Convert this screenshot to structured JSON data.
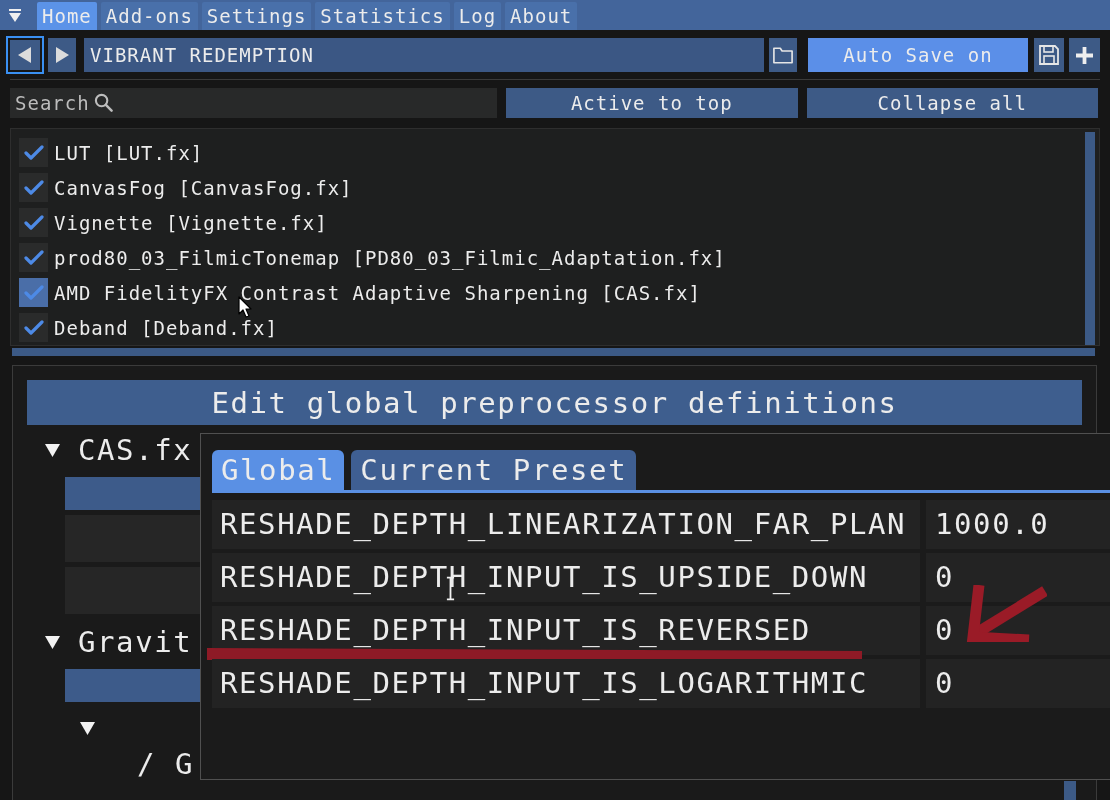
{
  "menu_tabs": [
    {
      "label": "Home",
      "selected": true
    },
    {
      "label": "Add-ons",
      "selected": false
    },
    {
      "label": "Settings",
      "selected": false
    },
    {
      "label": "Statistics",
      "selected": false
    },
    {
      "label": "Log",
      "selected": false
    },
    {
      "label": "About",
      "selected": false
    }
  ],
  "preset_bar": {
    "back_focused": true,
    "preset_name": "VIBRANT REDEMPTION",
    "auto_save": {
      "label": "Auto Save on",
      "on": true
    }
  },
  "search": {
    "placeholder": "Search"
  },
  "list_buttons": [
    "Active to top",
    "Collapse all"
  ],
  "effects": [
    {
      "label": "LUT [LUT.fx]",
      "checked": true,
      "hovered": false
    },
    {
      "label": "CanvasFog [CanvasFog.fx]",
      "checked": true,
      "hovered": false
    },
    {
      "label": "Vignette [Vignette.fx]",
      "checked": true,
      "hovered": false
    },
    {
      "label": "prod80_03_FilmicTonemap [PD80_03_Filmic_Adaptation.fx]",
      "checked": true,
      "hovered": false
    },
    {
      "label": "AMD FidelityFX Contrast Adaptive Sharpening [CAS.fx]",
      "checked": true,
      "hovered": true
    },
    {
      "label": "Deband [Deband.fx]",
      "checked": true,
      "hovered": false
    }
  ],
  "definitions": {
    "title": "Edit global preprocessor definitions",
    "tree": [
      {
        "label": "CAS.fx",
        "expanded": true,
        "children": [
          {
            "kind": "button"
          },
          {
            "kind": "field"
          },
          {
            "kind": "field"
          }
        ]
      },
      {
        "label": "Gravit",
        "expanded": true,
        "children": [
          {
            "kind": "button"
          },
          {
            "kind": "node",
            "expanded": true
          },
          {
            "kind": "category",
            "label": "/ G"
          }
        ]
      }
    ],
    "tabs": [
      {
        "label": "Global",
        "selected": true
      },
      {
        "label": "Current Preset",
        "selected": false
      }
    ],
    "rows": [
      {
        "name": "RESHADE_DEPTH_LINEARIZATION_FAR_PLAN",
        "value": "1000.0",
        "marked": false
      },
      {
        "name": "RESHADE_DEPTH_INPUT_IS_UPSIDE_DOWN",
        "value": "0",
        "marked": false
      },
      {
        "name": "RESHADE_DEPTH_INPUT_IS_REVERSED",
        "value": "0",
        "marked": true
      },
      {
        "name": "RESHADE_DEPTH_INPUT_IS_LOGARITHMIC",
        "value": "0",
        "marked": false
      }
    ]
  }
}
